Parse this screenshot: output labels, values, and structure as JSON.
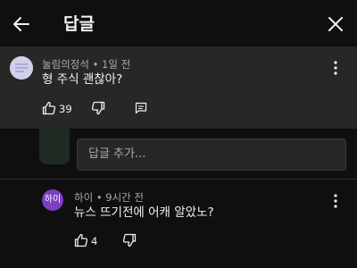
{
  "header": {
    "title": "답글"
  },
  "parent_comment": {
    "author": "눌림의정석",
    "time": "1일 전",
    "text": "형 주식 괜찮아?",
    "likes": "39"
  },
  "reply_box": {
    "placeholder": "답글 추가..."
  },
  "replies": [
    {
      "avatar_text": "하이",
      "author": "하이",
      "time": "9시간 전",
      "text": "뉴스 뜨기전에 어캐 알았노?",
      "likes": "4"
    }
  ],
  "colors": {
    "background": "#0f0f0f",
    "highlight": "#272727",
    "reply_avatar": "#7b3fbf"
  }
}
